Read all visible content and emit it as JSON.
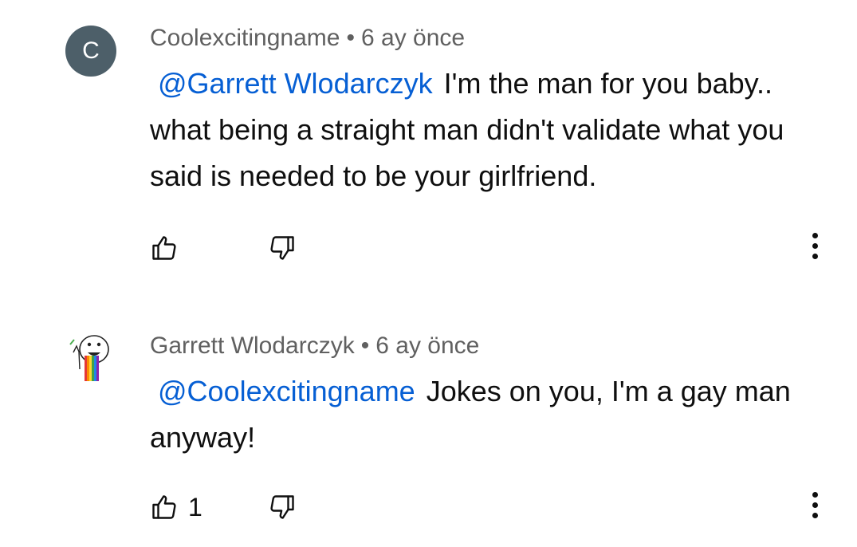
{
  "comments": [
    {
      "avatar_letter": "C",
      "author": "Coolexcitingname",
      "separator": "•",
      "time": "6 ay önce",
      "mention": "@Garrett Wlodarczyk",
      "text": "I'm the man for you baby.. what  being a straight man didn't validate what you said is needed to be your girlfriend.",
      "likes": "",
      "icons": {
        "like": "thumbs-up-icon",
        "dislike": "thumbs-down-icon",
        "more": "more-vert-icon"
      }
    },
    {
      "avatar_letter": "",
      "author": "Garrett Wlodarczyk",
      "separator": "•",
      "time": "6 ay önce",
      "mention": "@Coolexcitingname",
      "text": "Jokes on you, I'm a gay man anyway!",
      "likes": "1",
      "icons": {
        "like": "thumbs-up-icon",
        "dislike": "thumbs-down-icon",
        "more": "more-vert-icon"
      }
    }
  ],
  "colors": {
    "mention": "#065fd4",
    "meta": "#606060",
    "avatar_bg": "#4d5f69",
    "text": "#0f0f0f"
  }
}
